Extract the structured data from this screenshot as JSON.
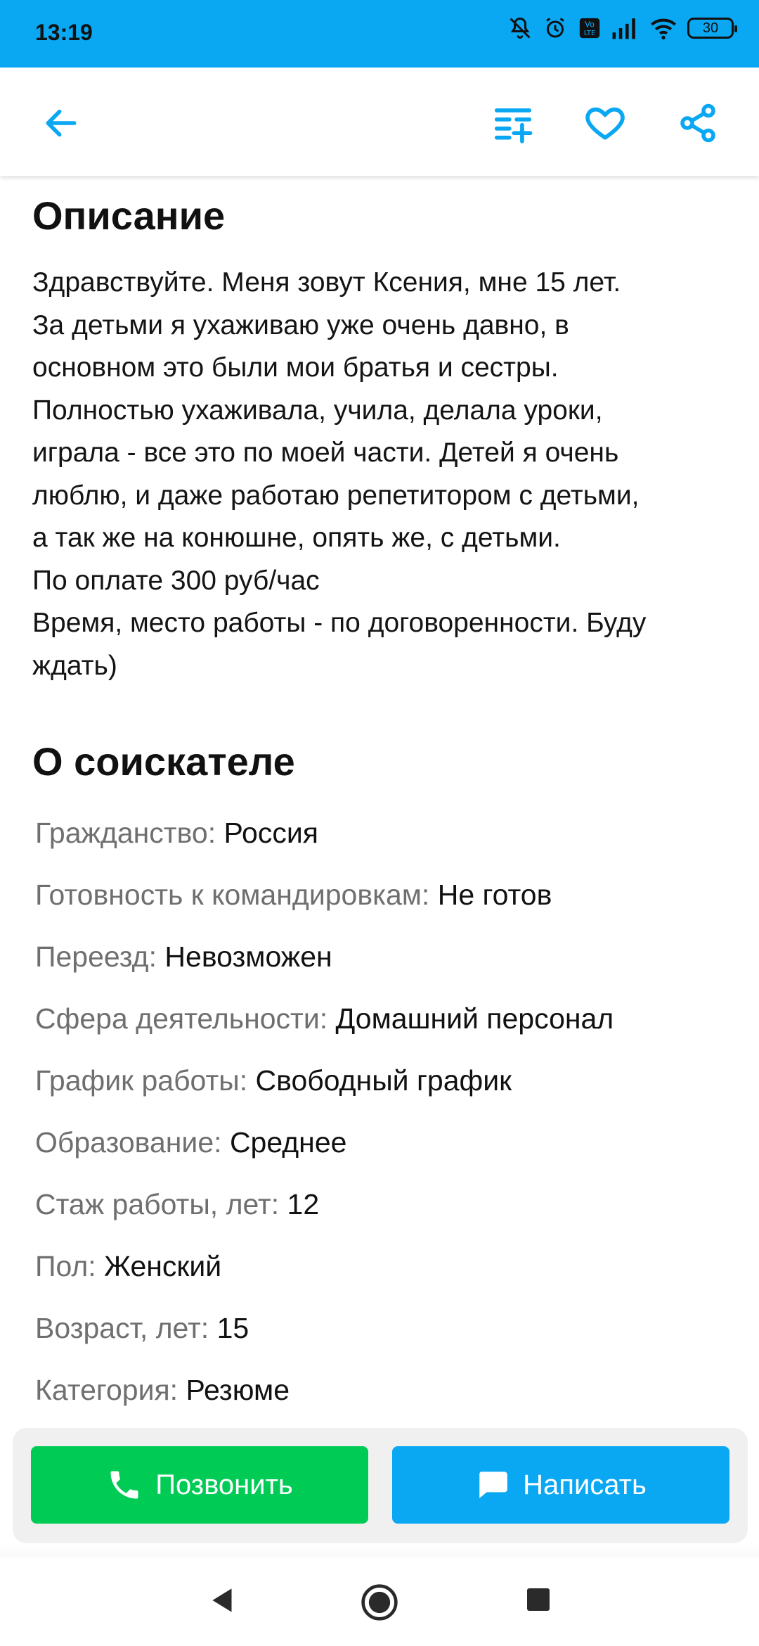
{
  "status_bar": {
    "time": "13:19",
    "battery": "30"
  },
  "app_bar": {
    "back_icon": "arrow-left-icon",
    "actions": [
      "filter-add-icon",
      "heart-icon",
      "share-icon"
    ],
    "accent_color": "#0aa7f3"
  },
  "description": {
    "title": "Описание",
    "text": "Здравствуйте. Меня зовут Ксения, мне 15 лет.\nЗа детьми я ухаживаю уже очень давно, в\nосновном это были мои братья и сестры.\nПолностью ухаживала, учила, делала уроки,\nиграла - все это по моей части. Детей я очень\nлюблю, и даже работаю репетитором с детьми,\nа так же на конюшне, опять же, с детьми.\nПо оплате 300 руб/час\nВремя, место работы - по договоренности. Буду\nждать)"
  },
  "about": {
    "title": "О соискателе",
    "fields": [
      {
        "label": "Гражданство:",
        "value": "Россия"
      },
      {
        "label": "Готовность к командировкам:",
        "value": "Не готов"
      },
      {
        "label": "Переезд:",
        "value": "Невозможен"
      },
      {
        "label": "Сфера деятельности:",
        "value": "Домашний персонал"
      },
      {
        "label": "График работы:",
        "value": "Свободный график"
      },
      {
        "label": "Образование:",
        "value": "Среднее"
      },
      {
        "label": "Стаж работы, лет:",
        "value": "12"
      },
      {
        "label": "Пол:",
        "value": "Женский"
      },
      {
        "label": "Возраст, лет:",
        "value": "15"
      },
      {
        "label": "Категория:",
        "value": "Резюме"
      }
    ]
  },
  "actions": {
    "call_label": "Позвонить",
    "write_label": "Написать",
    "call_color": "#00cc55",
    "write_color": "#0aa7f3"
  },
  "nav": {
    "items": [
      "back-triangle-icon",
      "home-circle-icon",
      "recents-square-icon"
    ]
  }
}
